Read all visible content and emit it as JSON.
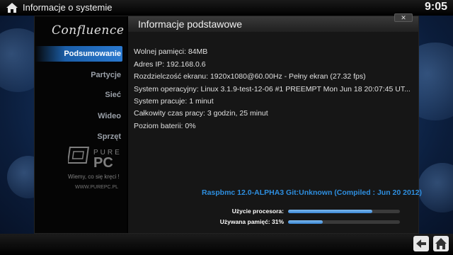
{
  "topbar": {
    "title": "Informacje o systemie",
    "clock": "9:05",
    "icon": "home-icon"
  },
  "sidebar": {
    "logo_text": "Confluence",
    "items": [
      {
        "label": "Podsumowanie",
        "active": true
      },
      {
        "label": "Partycje",
        "active": false
      },
      {
        "label": "Sieć",
        "active": false
      },
      {
        "label": "Wideo",
        "active": false
      },
      {
        "label": "Sprzęt",
        "active": false
      }
    ]
  },
  "watermark": {
    "brand": "PURE PC",
    "slogan": "Wiemy, co się kręci !",
    "site": "WWW.PUREPC.PL"
  },
  "panel": {
    "title": "Informacje podstawowe",
    "close_icon": "close-icon",
    "lines": [
      "Wolnej pamięci: 84MB",
      "Adres IP: 192.168.0.6",
      "Rozdzielczość ekranu: 1920x1080@60.00Hz - Pełny ekran (27.32 fps)",
      "System operacyjny: Linux 3.1.9-test-12-06 #1 PREEMPT Mon Jun 18 20:07:45 UT...",
      "System pracuje: 1 minut",
      "Całkowity czas pracy: 3 godzin, 25 minut",
      "Poziom baterii: 0%"
    ],
    "build": "Raspbmc 12.0-ALPHA3 Git:Unknown (Compiled : Jun 20 2012)",
    "cpu_label": "Użycie procesora:",
    "cpu_level": 0.75,
    "mem_label": "Używana pamięć: 31%",
    "mem_level": 0.31
  },
  "bottombar": {
    "back_icon": "back-arrow-icon",
    "home_icon": "home-icon"
  },
  "colors": {
    "accent": "#2a79cf",
    "build_text": "#2e8fe0"
  }
}
